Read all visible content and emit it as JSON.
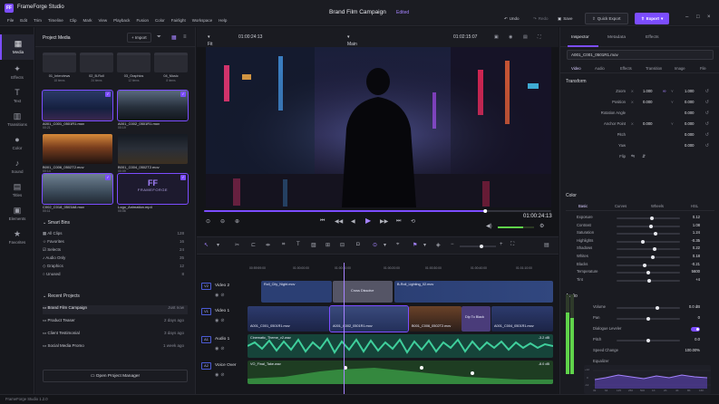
{
  "app": {
    "name": "FrameForge Studio",
    "logo": "FF",
    "project": "Brand Film Campaign",
    "edited": "Edited",
    "version": "FrameForge Studio 1.2.0"
  },
  "menu": [
    "File",
    "Edit",
    "Trim",
    "Timeline",
    "Clip",
    "Mark",
    "View",
    "Playback",
    "Fusion",
    "Color",
    "Fairlight",
    "Workspace",
    "Help"
  ],
  "top": {
    "undo": "Undo",
    "redo": "Redo",
    "save": "Save",
    "quick": "Quick Export",
    "export": "Export"
  },
  "nav": [
    {
      "icon": "▦",
      "label": "Media"
    },
    {
      "icon": "✦",
      "label": "Effects"
    },
    {
      "icon": "T",
      "label": "Text"
    },
    {
      "icon": "▥",
      "label": "Transitions"
    },
    {
      "icon": "●",
      "label": "Color"
    },
    {
      "icon": "♪",
      "label": "Sound"
    },
    {
      "icon": "▤",
      "label": "Titles"
    },
    {
      "icon": "▣",
      "label": "Elements"
    },
    {
      "icon": "★",
      "label": "Favorites"
    }
  ],
  "media": {
    "title": "Project Media",
    "import": "Import",
    "folders": [
      {
        "name": "01_Interviews",
        "count": "18 items"
      },
      {
        "name": "02_B-Roll",
        "count": "24 items"
      },
      {
        "name": "03_Graphics",
        "count": "12 items"
      },
      {
        "name": "04_Music",
        "count": "8 items"
      }
    ],
    "clips": [
      {
        "name": "A001_C001_0501R1.mov",
        "dur": "00:21"
      },
      {
        "name": "A001_C002_0501R1.mov",
        "dur": "00:19"
      },
      {
        "name": "B001_C006_0502T2.mov",
        "dur": "00:14"
      },
      {
        "name": "B001_C004_0502T2.mov",
        "dur": "00:09"
      },
      {
        "name": "C002_C018_0503A8.mov",
        "dur": "00:11"
      },
      {
        "name": "Logo_Animation.mp4",
        "dur": "00:06"
      }
    ],
    "logo_text": "FRAMEFORGE",
    "smart_bins_title": "Smart Bins",
    "bins": [
      {
        "name": "All Clips",
        "count": "128"
      },
      {
        "name": "Favorites",
        "count": "16"
      },
      {
        "name": "Selects",
        "count": "24"
      },
      {
        "name": "Audio Only",
        "count": "35"
      },
      {
        "name": "Graphics",
        "count": "12"
      },
      {
        "name": "Unused",
        "count": "8"
      }
    ],
    "recent_title": "Recent Projects",
    "recent": [
      {
        "name": "Brand Film Campaign",
        "when": "Just now"
      },
      {
        "name": "Product Teaser",
        "when": "2 days ago"
      },
      {
        "name": "Client Testimonial",
        "when": "3 days ago"
      },
      {
        "name": "Social Media Promo",
        "when": "1 week ago"
      }
    ],
    "open_manager": "Open Project Manager"
  },
  "viewer": {
    "fit": "Fit",
    "timecode_left": "01:00:24:13",
    "edit": "Main Edit",
    "timecode_right": "01:02:15:07",
    "current": "01:00:24:13",
    "progress": 0.81
  },
  "timeline": {
    "ruler": [
      "00:59:59:00",
      "01:00:00:00",
      "01:00:10:00",
      "01:00:20:00",
      "01:00:30:00",
      "01:00:40:00",
      "01:01:00:00",
      "01:01:10:00",
      "01:01:20:00"
    ],
    "tracks": [
      {
        "id": "V2",
        "name": "Video 2"
      },
      {
        "id": "V1",
        "name": "Video 1"
      },
      {
        "id": "A1",
        "name": "Audio 1"
      },
      {
        "id": "A2",
        "name": "Voice Over"
      }
    ],
    "v2": [
      {
        "name": "Roll_City_Night.mov"
      },
      {
        "name": "Cross Dissolve"
      },
      {
        "name": "B-Roll_Lighting_02.mov"
      }
    ],
    "v1": [
      {
        "name": "A001_C001_0501R1.mov"
      },
      {
        "name": "A001_C002_0501R1.mov"
      },
      {
        "name": "B001_C006_0502T2.mov"
      },
      {
        "name": "Dip To Black"
      },
      {
        "name": "A001_C004_0501R1.mov"
      }
    ],
    "a1": {
      "name": "Cinematic_Theme_v2.wav",
      "db": "-3.2 dB"
    },
    "a2": {
      "name": "VO_Final_Take.wav",
      "db": "-8.0 dB"
    }
  },
  "inspector": {
    "tabs": [
      "Inspector",
      "Metadata",
      "Effects"
    ],
    "clip": "A001_C001_0501R1.mov",
    "sub": [
      "Video",
      "Audio",
      "Effects",
      "Transition",
      "Image",
      "File"
    ],
    "transform_title": "Transform",
    "transform": [
      {
        "label": "Zoom",
        "x": "1.000",
        "y": "1.000"
      },
      {
        "label": "Position",
        "x": "0.000",
        "y": "0.000"
      },
      {
        "label": "Rotation Angle",
        "x": "",
        "y": "0.000"
      },
      {
        "label": "Anchor Point",
        "x": "0.000",
        "y": "0.000"
      },
      {
        "label": "Pitch",
        "x": "",
        "y": "0.000"
      },
      {
        "label": "Yaw",
        "x": "",
        "y": "0.000"
      },
      {
        "label": "Flip",
        "x": "",
        "y": ""
      }
    ],
    "color_title": "Color",
    "color_tabs": [
      "Basic",
      "Curves",
      "Wheels",
      "HSL"
    ],
    "color": [
      {
        "label": "Exposure",
        "value": "0.12",
        "pos": 0.56
      },
      {
        "label": "Contrast",
        "value": "1.08",
        "pos": 0.54
      },
      {
        "label": "Saturation",
        "value": "1.24",
        "pos": 0.62
      },
      {
        "label": "Highlights",
        "value": "-0.35",
        "pos": 0.41
      },
      {
        "label": "Shadows",
        "value": "0.22",
        "pos": 0.6
      },
      {
        "label": "Whites",
        "value": "0.18",
        "pos": 0.58
      },
      {
        "label": "Blacks",
        "value": "-0.21",
        "pos": 0.44
      },
      {
        "label": "Temperature",
        "value": "5600",
        "pos": 0.5
      },
      {
        "label": "Tint",
        "value": "+4",
        "pos": 0.52
      }
    ],
    "audio_title": "Audio",
    "audio": [
      {
        "label": "Volume",
        "value": "0.0 dB"
      },
      {
        "label": "Pan",
        "value": "0"
      },
      {
        "label": "Dialogue Leveler",
        "value": ""
      },
      {
        "label": "Pitch",
        "value": "0.0"
      },
      {
        "label": "Speed Change",
        "value": "100.00%"
      }
    ],
    "eq_title": "Equalizer",
    "eq_freqs": [
      "32",
      "64",
      "125",
      "250",
      "500",
      "1K",
      "2K",
      "4K",
      "8K",
      "16K"
    ],
    "eq_db": [
      "+12",
      "0",
      "-12"
    ]
  }
}
